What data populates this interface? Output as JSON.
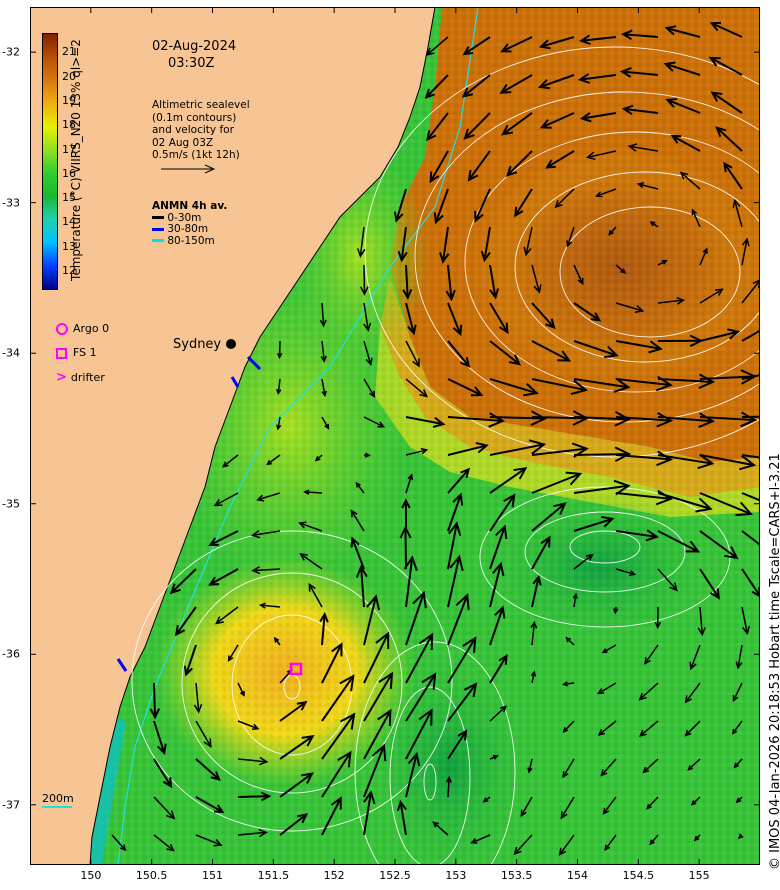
{
  "map": {
    "date": "02-Aug-2024",
    "time": "03:30Z",
    "region": {
      "lon_range": [
        149.5,
        155.5
      ],
      "lat_range": [
        -37.4,
        -31.7
      ]
    }
  },
  "colorbar": {
    "title": "Temperature (°C) VIIRS_N20 13% ql>=2",
    "ticks": [
      "21",
      "20",
      "19",
      "18",
      "17",
      "16",
      "15",
      "14",
      "13",
      "12"
    ],
    "range": [
      11.3,
      21.8
    ],
    "colors": [
      "#00008b",
      "#0040ff",
      "#00c0ff",
      "#20d0b0",
      "#18b830",
      "#30d030",
      "#90e020",
      "#e8f000",
      "#f0b010",
      "#d87810",
      "#b85008",
      "#802000"
    ]
  },
  "sealevel_note": {
    "lines": [
      "Altimetric sealevel",
      "(0.1m contours)",
      "and velocity for",
      "02 Aug 03Z",
      "0.5m/s (1kt 12h)"
    ]
  },
  "anmn": {
    "title": "ANMN 4h av.",
    "items": [
      {
        "label": "0-30m",
        "color": "#000000"
      },
      {
        "label": "30-80m",
        "color": "#0000ff"
      },
      {
        "label": "80-150m",
        "color": "#00e0e0"
      }
    ]
  },
  "legend": {
    "items": [
      {
        "label": "Argo 0",
        "shape": "circle",
        "color": "#ff00ff"
      },
      {
        "label": "FS 1",
        "shape": "square",
        "color": "#ff00ff"
      },
      {
        "label": "drifter",
        "shape": "chevron",
        "color": "#ff00ff"
      }
    ]
  },
  "places": {
    "sydney": "Sydney"
  },
  "isobath_label": "200m",
  "axes": {
    "x_ticks": [
      "150",
      "150.5",
      "151",
      "151.5",
      "152",
      "152.5",
      "153",
      "153.5",
      "154",
      "154.5",
      "155"
    ],
    "y_ticks": [
      "-32",
      "-33",
      "-34",
      "-35",
      "-36",
      "-37"
    ]
  },
  "footer": "© IMOS 04-Jan-2026 20:18:53 Hobart time Tscale=CARS+l-3.21"
}
